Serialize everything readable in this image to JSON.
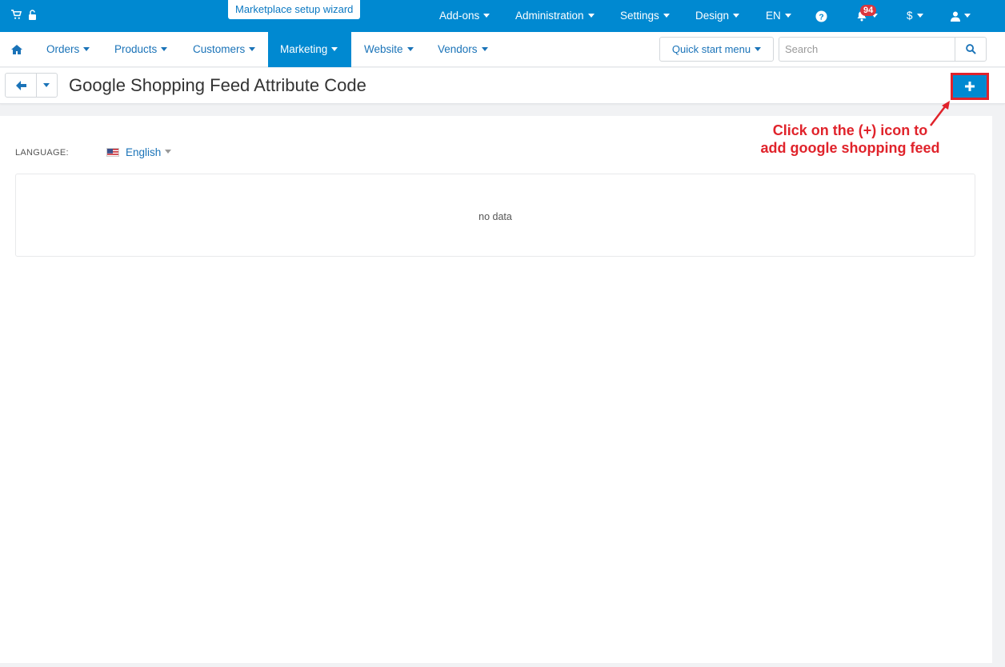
{
  "topbar": {
    "wizard_label": "Marketplace setup wizard",
    "menu": [
      {
        "label": "Add-ons"
      },
      {
        "label": "Administration"
      },
      {
        "label": "Settings"
      },
      {
        "label": "Design"
      },
      {
        "label": "EN"
      }
    ],
    "notifications_count": "94",
    "currency": "$"
  },
  "nav": {
    "items": [
      {
        "label": "Orders"
      },
      {
        "label": "Products"
      },
      {
        "label": "Customers"
      },
      {
        "label": "Marketing"
      },
      {
        "label": "Website"
      },
      {
        "label": "Vendors"
      }
    ],
    "quick_start": "Quick start menu",
    "search_placeholder": "Search"
  },
  "page": {
    "title": "Google Shopping Feed Attribute Code",
    "language_label": "LANGUAGE:",
    "language_value": "English",
    "empty_text": "no data"
  },
  "annotation": {
    "line1": "Click on the (+) icon to",
    "line2": "add google shopping feed"
  },
  "colors": {
    "primary": "#0089d1",
    "annotation": "#e0232b",
    "badge": "#d9363e"
  }
}
